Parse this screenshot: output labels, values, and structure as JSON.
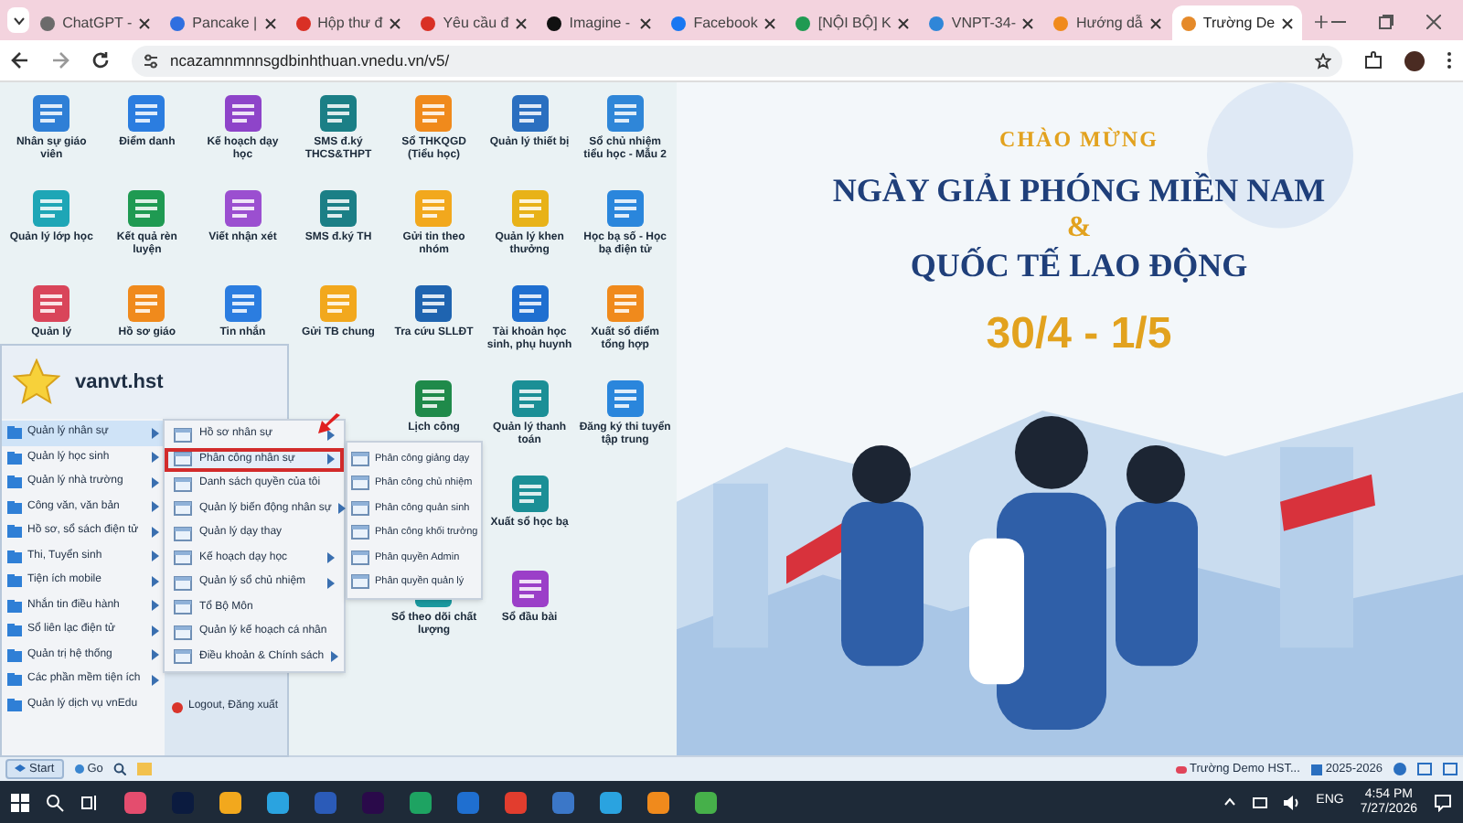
{
  "tabs": [
    {
      "label": "ChatGPT -",
      "selected": false
    },
    {
      "label": "Pancake |",
      "selected": false
    },
    {
      "label": "Hộp thư đ",
      "selected": false
    },
    {
      "label": "Yêu cầu đ",
      "selected": false
    },
    {
      "label": "Imagine -",
      "selected": false
    },
    {
      "label": "Facebook",
      "selected": false
    },
    {
      "label": "[NỘI BỘ] K",
      "selected": false
    },
    {
      "label": "VNPT-34-",
      "selected": false
    },
    {
      "label": "Hướng dẫ",
      "selected": false
    },
    {
      "label": "Trường De",
      "selected": true
    }
  ],
  "address_bar": {
    "url": "ncazamnmnnsgdbinhthuan.vnedu.vn/v5/"
  },
  "desktop_icons": [
    [
      {
        "label": "Nhân sự giáo viên",
        "color": "#2f7fd6"
      },
      {
        "label": "Điểm danh",
        "color": "#2b7de0"
      },
      {
        "label": "Kế hoạch dạy học",
        "color": "#8e44c9"
      },
      {
        "label": "SMS đ.ký THCS&THPT",
        "color": "#1b7f86"
      },
      {
        "label": "Sổ THKQGD (Tiểu học)",
        "color": "#f08a1c"
      },
      {
        "label": "Quản lý thiết bị",
        "color": "#2a6fc0"
      },
      {
        "label": "Sổ chủ nhiệm tiểu học - Mẫu 2",
        "color": "#2f86d8"
      }
    ],
    [
      {
        "label": "Quản lý lớp học",
        "color": "#1ea6b6"
      },
      {
        "label": "Kết quả rèn luyện",
        "color": "#1f9a52"
      },
      {
        "label": "Viết nhận xét",
        "color": "#9b4fd0"
      },
      {
        "label": "SMS đ.ký TH",
        "color": "#1b7f86"
      },
      {
        "label": "Gửi tin theo nhóm",
        "color": "#f2a81d"
      },
      {
        "label": "Quản lý khen thưởng",
        "color": "#e8b218"
      },
      {
        "label": "Học bạ số - Học bạ điện tử",
        "color": "#2a86dc"
      }
    ],
    [
      {
        "label": "Quản lý",
        "color": "#d9455a"
      },
      {
        "label": "Hồ sơ giáo",
        "color": "#f08a1c"
      },
      {
        "label": "Tin nhắn",
        "color": "#2b7de0"
      },
      {
        "label": "Gửi TB chung",
        "color": "#f2a81d"
      },
      {
        "label": "Tra cứu SLLĐT",
        "color": "#1f64b0"
      },
      {
        "label": "Tài khoản học sinh, phụ huynh",
        "color": "#1f6fd0"
      },
      {
        "label": "Xuất sổ điểm tổng hợp",
        "color": "#f08a1c"
      }
    ],
    [
      {
        "label": "Lịch công",
        "color": "#1f8a4a"
      },
      {
        "label": "Quản lý thanh toán",
        "color": "#1b8f96"
      },
      {
        "label": "Đăng ký thi tuyển tập trung",
        "color": "#2a86dc"
      },
      {
        "label": "Xuất sổ học bạ",
        "color": "#1b8f96"
      },
      {
        "label": "Sổ theo dõi chất lượng",
        "color": "#1b9aa0"
      },
      {
        "label": "Sổ đầu bài",
        "color": "#9b3fc8"
      }
    ]
  ],
  "banner": {
    "greeting": "CHÀO MỪNG",
    "line1": "NGÀY GIẢI PHÓNG MIỀN NAM",
    "ampersand": "&",
    "line2": "QUỐC TẾ LAO ĐỘNG",
    "date": "30/4 - 1/5"
  },
  "start_menu": {
    "user": "vanvt.hst",
    "items": [
      {
        "label": "Quản lý nhân sự",
        "submenu": true,
        "selected": true
      },
      {
        "label": "Quản lý học sinh",
        "submenu": true,
        "selected": false
      },
      {
        "label": "Quản lý nhà trường",
        "submenu": true,
        "selected": false
      },
      {
        "label": "Công văn, văn bản",
        "submenu": true,
        "selected": false
      },
      {
        "label": "Hồ sơ, sổ sách điện tử",
        "submenu": true,
        "selected": false
      },
      {
        "label": "Thi, Tuyển sinh",
        "submenu": true,
        "selected": false
      },
      {
        "label": "Tiện ích mobile",
        "submenu": true,
        "selected": false
      },
      {
        "label": "Nhắn tin điều hành",
        "submenu": true,
        "selected": false
      },
      {
        "label": "Sổ liên lạc điện tử",
        "submenu": true,
        "selected": false
      },
      {
        "label": "Quản trị hệ thống",
        "submenu": true,
        "selected": false
      },
      {
        "label": "Các phần mềm tiện ích",
        "submenu": true,
        "selected": false
      },
      {
        "label": "Quản lý dịch vụ vnEdu",
        "submenu": false,
        "selected": false
      }
    ],
    "logout": "Logout, Đăng xuất"
  },
  "submenu": [
    {
      "label": "Hồ sơ nhân sự",
      "submenu": true,
      "selected": false
    },
    {
      "label": "Phân công nhân sự",
      "submenu": true,
      "selected": true
    },
    {
      "label": "Danh sách quyền của tôi",
      "submenu": false,
      "selected": false
    },
    {
      "label": "Quản lý biến động nhân sự",
      "submenu": true,
      "selected": false
    },
    {
      "label": "Quản lý dạy thay",
      "submenu": false,
      "selected": false
    },
    {
      "label": "Kế hoạch dạy học",
      "submenu": true,
      "selected": false
    },
    {
      "label": "Quản lý sổ chủ nhiệm",
      "submenu": true,
      "selected": false
    },
    {
      "label": "Tổ Bộ Môn",
      "submenu": false,
      "selected": false
    },
    {
      "label": "Quản lý kế hoạch cá nhân",
      "submenu": false,
      "selected": false
    },
    {
      "label": "Điều khoản & Chính sách",
      "submenu": true,
      "selected": false
    }
  ],
  "sub_submenu": [
    "Phân công giảng dạy",
    "Phân công chủ nhiệm",
    "Phân công quản sinh",
    "Phân công khối trưởng",
    "Phân quyền Admin",
    "Phân quyền quản lý"
  ],
  "app_bar": {
    "start": "Start",
    "go": "Go",
    "school": "Trường Demo HST...",
    "year": "2025-2026"
  },
  "taskbar": {
    "language": "ENG",
    "time": "4:54 PM",
    "date": "7/27/2026"
  }
}
